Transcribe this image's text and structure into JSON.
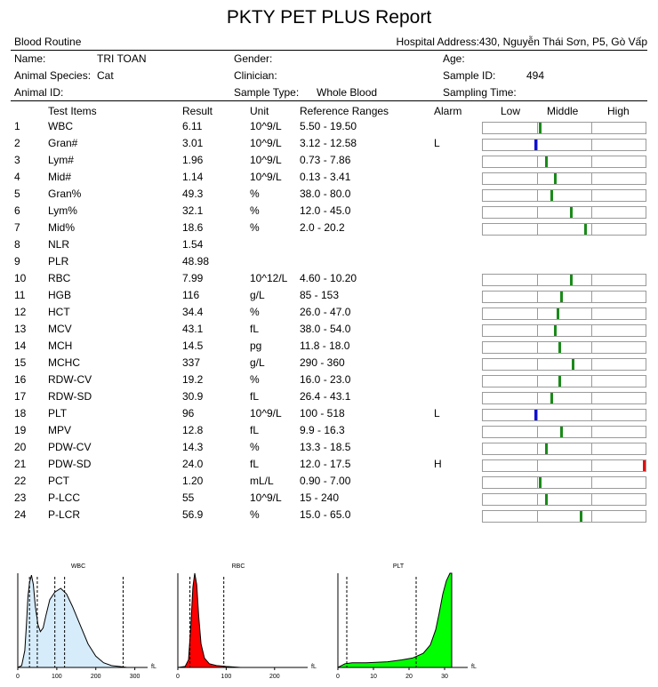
{
  "title": "PKTY PET PLUS Report",
  "header": {
    "section": "Blood Routine",
    "hospital": "Hospital Address:430, Nguyễn Thái Sơn, P5, Gò Vấp"
  },
  "patient": {
    "name_label": "Name:",
    "name_value": "TRI TOAN",
    "gender_label": "Gender:",
    "age_label": "Age:",
    "species_label": "Animal Species:",
    "species_value": "Cat",
    "clinician_label": "Clinician:",
    "sample_id_label": "Sample ID:",
    "sample_id_value": "494",
    "animal_id_label": "Animal ID:",
    "sample_type_label": "Sample Type:",
    "sample_type_value": "Whole Blood",
    "sampling_time_label": "Sampling Time:"
  },
  "columns": {
    "items": "Test Items",
    "result": "Result",
    "unit": "Unit",
    "ref": "Reference Ranges",
    "alarm": "Alarm",
    "low": "Low",
    "middle": "Middle",
    "high": "High"
  },
  "colors": {
    "normal": "#1a8a1a",
    "low": "#1010d0",
    "high": "#e01010"
  },
  "rows": [
    {
      "no": "1",
      "item": "WBC",
      "result": "6.11",
      "unit": "10^9/L",
      "ref": "5.50 - 19.50",
      "alarm": "",
      "level": 0.35
    },
    {
      "no": "2",
      "item": "Gran#",
      "result": "3.01",
      "unit": "10^9/L",
      "ref": "3.12 - 12.58",
      "alarm": "L",
      "level": 0.32
    },
    {
      "no": "3",
      "item": "Lym#",
      "result": "1.96",
      "unit": "10^9/L",
      "ref": "0.73 - 7.86",
      "alarm": "",
      "level": 0.39
    },
    {
      "no": "4",
      "item": "Mid#",
      "result": "1.14",
      "unit": "10^9/L",
      "ref": "0.13 - 3.41",
      "alarm": "",
      "level": 0.44
    },
    {
      "no": "5",
      "item": "Gran%",
      "result": "49.3",
      "unit": "%",
      "ref": "38.0 - 80.0",
      "alarm": "",
      "level": 0.42
    },
    {
      "no": "6",
      "item": "Lym%",
      "result": "32.1",
      "unit": "%",
      "ref": "12.0 - 45.0",
      "alarm": "",
      "level": 0.54
    },
    {
      "no": "7",
      "item": "Mid%",
      "result": "18.6",
      "unit": "%",
      "ref": "2.0 - 20.2",
      "alarm": "",
      "level": 0.63
    },
    {
      "no": "8",
      "item": "NLR",
      "result": "1.54",
      "unit": "",
      "ref": "",
      "alarm": "",
      "level": null
    },
    {
      "no": "9",
      "item": "PLR",
      "result": "48.98",
      "unit": "",
      "ref": "",
      "alarm": "",
      "level": null
    },
    {
      "no": "10",
      "item": "RBC",
      "result": "7.99",
      "unit": "10^12/L",
      "ref": "4.60 - 10.20",
      "alarm": "",
      "level": 0.54
    },
    {
      "no": "11",
      "item": "HGB",
      "result": "116",
      "unit": "g/L",
      "ref": "85 - 153",
      "alarm": "",
      "level": 0.48
    },
    {
      "no": "12",
      "item": "HCT",
      "result": "34.4",
      "unit": "%",
      "ref": "26.0 - 47.0",
      "alarm": "",
      "level": 0.46
    },
    {
      "no": "13",
      "item": "MCV",
      "result": "43.1",
      "unit": "fL",
      "ref": "38.0 - 54.0",
      "alarm": "",
      "level": 0.44
    },
    {
      "no": "14",
      "item": "MCH",
      "result": "14.5",
      "unit": "pg",
      "ref": "11.8 - 18.0",
      "alarm": "",
      "level": 0.47
    },
    {
      "no": "15",
      "item": "MCHC",
      "result": "337",
      "unit": "g/L",
      "ref": "290 - 360",
      "alarm": "",
      "level": 0.55
    },
    {
      "no": "16",
      "item": "RDW-CV",
      "result": "19.2",
      "unit": "%",
      "ref": "16.0 - 23.0",
      "alarm": "",
      "level": 0.47
    },
    {
      "no": "17",
      "item": "RDW-SD",
      "result": "30.9",
      "unit": "fL",
      "ref": "26.4 - 43.1",
      "alarm": "",
      "level": 0.42
    },
    {
      "no": "18",
      "item": "PLT",
      "result": "96",
      "unit": "10^9/L",
      "ref": "100 - 518",
      "alarm": "L",
      "level": 0.32
    },
    {
      "no": "19",
      "item": "MPV",
      "result": "12.8",
      "unit": "fL",
      "ref": "9.9 - 16.3",
      "alarm": "",
      "level": 0.48
    },
    {
      "no": "20",
      "item": "PDW-CV",
      "result": "14.3",
      "unit": "%",
      "ref": "13.3 - 18.5",
      "alarm": "",
      "level": 0.39
    },
    {
      "no": "21",
      "item": "PDW-SD",
      "result": "24.0",
      "unit": "fL",
      "ref": "12.0 - 17.5",
      "alarm": "H",
      "level": 0.99
    },
    {
      "no": "22",
      "item": "PCT",
      "result": "1.20",
      "unit": "mL/L",
      "ref": "0.90 - 7.00",
      "alarm": "",
      "level": 0.35
    },
    {
      "no": "23",
      "item": "P-LCC",
      "result": "55",
      "unit": "10^9/L",
      "ref": "15 - 240",
      "alarm": "",
      "level": 0.39
    },
    {
      "no": "24",
      "item": "P-LCR",
      "result": "56.9",
      "unit": "%",
      "ref": "15.0 - 65.0",
      "alarm": "",
      "level": 0.6
    }
  ],
  "histograms": [
    {
      "name": "WBC",
      "fill": "#d6ecfa",
      "stroke": "#000000",
      "unit": "fL",
      "ticks": [
        "0",
        "100",
        "200",
        "300"
      ],
      "tick_values": [
        0,
        100,
        200,
        300
      ],
      "xmax": 310,
      "lines": [
        30,
        50,
        95,
        120,
        270
      ],
      "curve": [
        [
          0,
          0
        ],
        [
          10,
          2
        ],
        [
          18,
          18
        ],
        [
          22,
          45
        ],
        [
          26,
          75
        ],
        [
          30,
          90
        ],
        [
          35,
          98
        ],
        [
          40,
          88
        ],
        [
          45,
          65
        ],
        [
          52,
          45
        ],
        [
          58,
          38
        ],
        [
          65,
          42
        ],
        [
          72,
          55
        ],
        [
          82,
          72
        ],
        [
          95,
          80
        ],
        [
          110,
          84
        ],
        [
          125,
          78
        ],
        [
          140,
          65
        ],
        [
          160,
          45
        ],
        [
          180,
          25
        ],
        [
          200,
          12
        ],
        [
          220,
          5
        ],
        [
          240,
          2
        ],
        [
          260,
          1
        ],
        [
          280,
          0
        ]
      ]
    },
    {
      "name": "RBC",
      "fill": "#ff0000",
      "stroke": "#000000",
      "unit": "fL",
      "ticks": [
        "0",
        "100",
        "200"
      ],
      "tick_values": [
        0,
        100,
        200
      ],
      "xmax": 250,
      "lines": [
        25,
        95
      ],
      "curve": [
        [
          0,
          0
        ],
        [
          15,
          1
        ],
        [
          22,
          8
        ],
        [
          27,
          45
        ],
        [
          31,
          85
        ],
        [
          35,
          100
        ],
        [
          39,
          88
        ],
        [
          43,
          55
        ],
        [
          48,
          25
        ],
        [
          55,
          10
        ],
        [
          65,
          4
        ],
        [
          80,
          2
        ],
        [
          100,
          1
        ],
        [
          130,
          0
        ]
      ]
    },
    {
      "name": "PLT",
      "fill": "#00ff00",
      "stroke": "#000000",
      "unit": "fL",
      "ticks": [
        "0",
        "10",
        "20",
        "30"
      ],
      "tick_values": [
        0,
        10,
        20,
        30
      ],
      "xmax": 34,
      "lines": [
        2.5,
        22
      ],
      "curve": [
        [
          0,
          0
        ],
        [
          1,
          2
        ],
        [
          2,
          4
        ],
        [
          4,
          5
        ],
        [
          8,
          5
        ],
        [
          14,
          6
        ],
        [
          18,
          8
        ],
        [
          21,
          10
        ],
        [
          24,
          15
        ],
        [
          26,
          24
        ],
        [
          27.5,
          40
        ],
        [
          28.5,
          58
        ],
        [
          29.5,
          78
        ],
        [
          30.5,
          92
        ],
        [
          31.5,
          100
        ],
        [
          32,
          100
        ],
        [
          32,
          0
        ]
      ]
    }
  ]
}
